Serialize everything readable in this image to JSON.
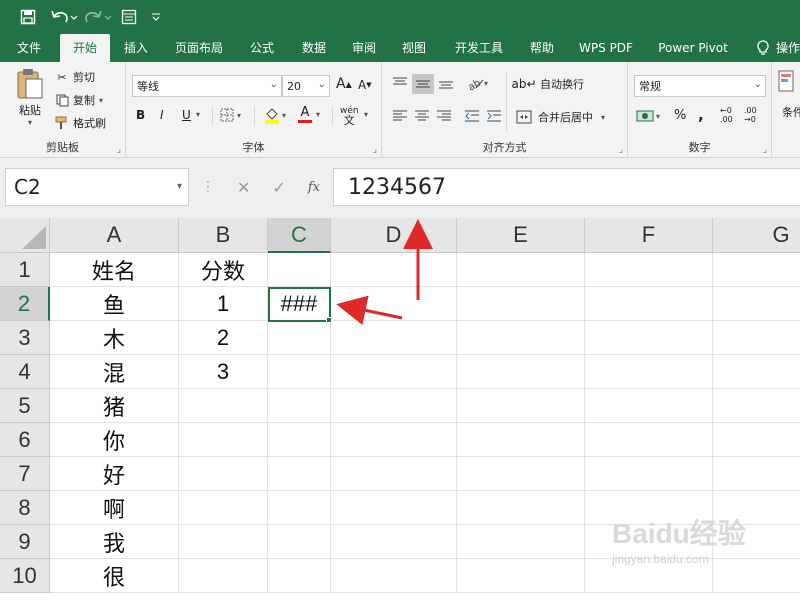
{
  "quick_access": {
    "save_icon": "save-icon",
    "undo_icon": "undo-icon",
    "redo_icon": "redo-icon",
    "form_icon": "form-icon",
    "customize_icon": "customize-icon"
  },
  "tabs": [
    {
      "label": "文件"
    },
    {
      "label": "开始"
    },
    {
      "label": "插入"
    },
    {
      "label": "页面布局"
    },
    {
      "label": "公式"
    },
    {
      "label": "数据"
    },
    {
      "label": "审阅"
    },
    {
      "label": "视图"
    },
    {
      "label": "开发工具"
    },
    {
      "label": "帮助"
    },
    {
      "label": "WPS PDF"
    },
    {
      "label": "Power Pivot"
    },
    {
      "label": "操作"
    }
  ],
  "ribbon": {
    "clipboard": {
      "title": "剪贴板",
      "paste": "粘贴",
      "cut": "剪切",
      "copy": "复制",
      "format_painter": "格式刷"
    },
    "font": {
      "title": "字体",
      "font_name": "等线",
      "font_size": "20",
      "bold": "B",
      "italic": "I",
      "underline": "U",
      "grow": "A",
      "shrink": "A",
      "color_a": "A",
      "phonetic": "wén"
    },
    "alignment": {
      "title": "对齐方式",
      "wrap_text": "自动换行",
      "merge_center": "合并后居中"
    },
    "number": {
      "title": "数字",
      "format": "常规",
      "percent": "%",
      "comma": ",",
      "inc_decimal": "←0 .00",
      "dec_decimal": ".00 →0"
    },
    "styles": {
      "conditional": "条件"
    }
  },
  "formula_bar": {
    "name_box": "C2",
    "cancel": "✕",
    "enter": "✓",
    "fx": "fx",
    "value": "1234567"
  },
  "columns": [
    "A",
    "B",
    "C",
    "D",
    "E",
    "F",
    "G"
  ],
  "rows": [
    "1",
    "2",
    "3",
    "4",
    "5",
    "6",
    "7",
    "8",
    "9",
    "10"
  ],
  "cells": {
    "A1": "姓名",
    "B1": "分数",
    "C1": "",
    "A2": "鱼",
    "B2": "1",
    "C2": "###",
    "A3": "木",
    "B3": "2",
    "A4": "混",
    "B4": "3",
    "A5": "猪",
    "A6": "你",
    "A7": "好",
    "A8": "啊",
    "A9": "我",
    "A10": "很"
  },
  "watermark": {
    "brand": "Baidu经验",
    "url": "jingyan.baidu.com"
  },
  "colors": {
    "excel_green": "#217346",
    "annotation_red": "#e02a2a"
  }
}
